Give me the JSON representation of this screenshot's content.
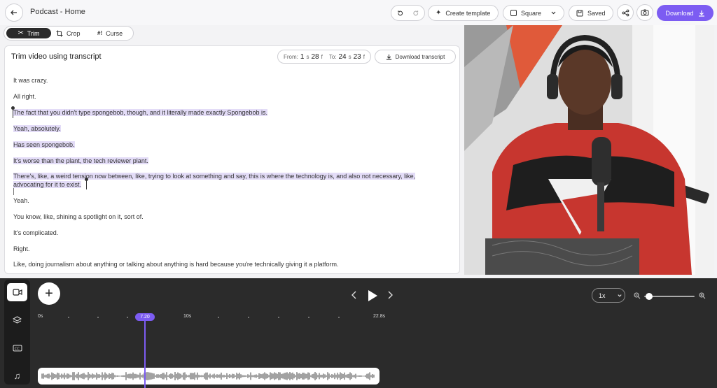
{
  "header": {
    "title": "Podcast - Home",
    "create_template": "Create template",
    "aspect": "Square",
    "saved": "Saved",
    "download": "Download"
  },
  "tools": [
    {
      "label": "Trim",
      "icon": "scissors-icon"
    },
    {
      "label": "Crop",
      "icon": "crop-icon"
    },
    {
      "label": "Curse",
      "icon": "curse-icon"
    }
  ],
  "transcript": {
    "title": "Trim video using transcript",
    "from_label": "From:",
    "from_sec": "1",
    "from_frame": "28",
    "to_label": "To:",
    "to_sec": "24",
    "to_frame": "23",
    "sec_unit": "s",
    "frame_unit": "f",
    "download_transcript": "Download transcript",
    "lines": [
      {
        "text": "It was crazy.",
        "highlighted": false
      },
      {
        "text": "All right.",
        "highlighted": false
      },
      {
        "text": "The fact that you didn't type spongebob, though, and it literally made exactly Spongebob is.",
        "highlighted": true
      },
      {
        "text": "Yeah, absolutely.",
        "highlighted": true
      },
      {
        "text": "Has seen spongebob.",
        "highlighted": true
      },
      {
        "text": "It's worse than the plant, the tech reviewer plant.",
        "highlighted": true
      },
      {
        "text": "There's, like, a weird tension now between, like, trying to look at something and say, this is where the technology is, and also not necessary, like,",
        "highlighted": true
      },
      {
        "text": "advocating for it to exist.",
        "highlighted": true
      },
      {
        "text": "Yeah.",
        "highlighted": false
      },
      {
        "text": "You know, like, shining a spotlight on it, sort of.",
        "highlighted": false
      },
      {
        "text": "It's complicated.",
        "highlighted": false
      },
      {
        "text": "Right.",
        "highlighted": false
      },
      {
        "text": "Like, doing journalism about anything or talking about anything is hard because you're technically giving it a platform.",
        "highlighted": false
      }
    ]
  },
  "timeline": {
    "speed": "1x",
    "ticks": [
      "0s",
      "10s",
      "22.8s"
    ],
    "playhead": "7.20",
    "zoom_level": 0.05
  },
  "colors": {
    "accent": "#7c5cf2",
    "highlight": "#e3dcf7",
    "timeline_bg": "#2b2b2b"
  }
}
